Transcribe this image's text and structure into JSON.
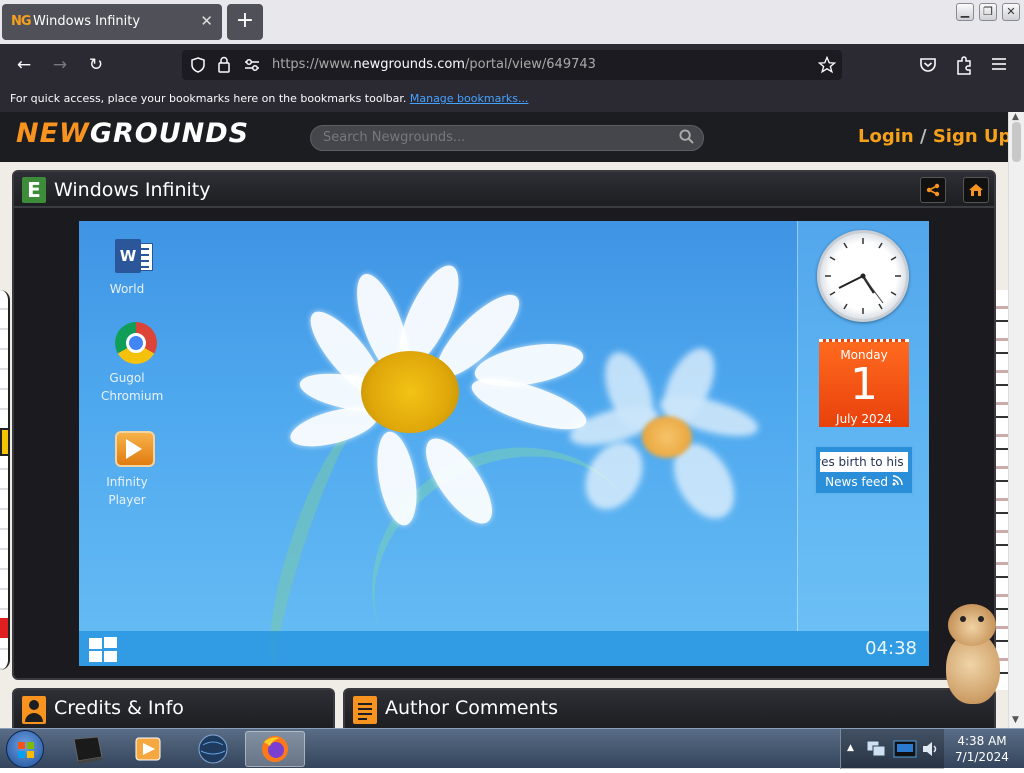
{
  "browser": {
    "tab": {
      "favicon": "NG",
      "title": "Windows Infinity",
      "close": "✕"
    },
    "new_tab": "+",
    "window_controls": {
      "minimize": "▁",
      "restore": "❐",
      "close": "✕"
    },
    "nav": {
      "back": "←",
      "forward": "→",
      "reload": "↻"
    },
    "url": {
      "prefix": "https://www.",
      "domain": "newgrounds.com",
      "path": "/portal/view/649743"
    },
    "bookmarks_bar": {
      "text": "For quick access, place your bookmarks here on the bookmarks toolbar. ",
      "link": "Manage bookmarks..."
    }
  },
  "newgrounds": {
    "logo_new": "NEW",
    "logo_grounds": "GROUNDS",
    "search_placeholder": "Search Newgrounds...",
    "login": "Login",
    "separator": " / ",
    "signup": "Sign Up"
  },
  "game_panel": {
    "badge": "E",
    "title": "Windows Infinity",
    "share_icon": "share-icon",
    "fullscreen_icon": "house-icon"
  },
  "game": {
    "desktop_icons": [
      {
        "label": "World",
        "icon": "word-icon"
      },
      {
        "label": "Gugol Chromium",
        "icon": "chromium-icon"
      },
      {
        "label": "Infinity Player",
        "icon": "player-icon"
      }
    ],
    "calendar": {
      "day": "Monday",
      "date": "1",
      "month": "July 2024"
    },
    "news": {
      "ticker": "ves birth to his",
      "label": "News feed"
    },
    "clock": "04:38"
  },
  "bottom_panels": {
    "credits": "Credits & Info",
    "comments": "Author Comments"
  },
  "taskbar": {
    "apps": [
      "terminal-icon",
      "media-player-icon",
      "globe-icon",
      "firefox-icon"
    ],
    "time": "4:38 AM",
    "date": "7/1/2024"
  },
  "colors": {
    "ng_orange": "#f7931e",
    "firefox_dark": "#2b2a33",
    "game_blue": "#4ea8ee"
  }
}
